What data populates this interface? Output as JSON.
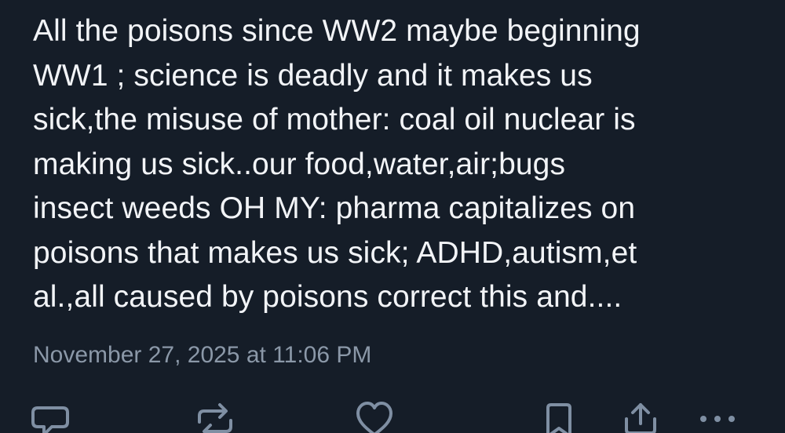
{
  "post": {
    "lines": [
      "All the poisons since WW2 maybe beginning",
      "WW1 ; science is deadly and it makes us",
      "sick,the misuse of mother: coal oil nuclear is",
      "making us sick..our food,water,air;bugs",
      "insect weeds OH MY: pharma capitalizes on",
      "poisons that makes us sick; ADHD,autism,et",
      "al.,all caused by poisons correct this and...."
    ],
    "timestamp": "November 27, 2025 at 11:06 PM"
  },
  "actions": [
    {
      "name": "reply",
      "icon": "reply-icon"
    },
    {
      "name": "repost",
      "icon": "repost-icon"
    },
    {
      "name": "like",
      "icon": "heart-icon"
    },
    {
      "name": "bookmark",
      "icon": "bookmark-icon"
    },
    {
      "name": "share",
      "icon": "share-icon"
    },
    {
      "name": "more",
      "icon": "more-icon"
    }
  ],
  "colors": {
    "background": "#151d28",
    "text": "#f2f4f7",
    "muted": "#8b98a8",
    "icon": "#7f8fa3"
  }
}
